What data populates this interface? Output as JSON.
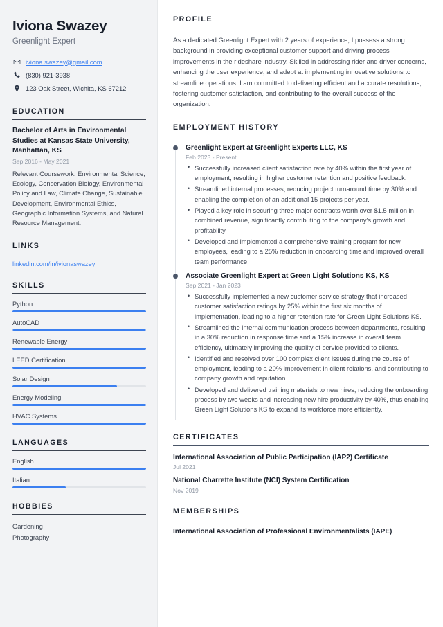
{
  "theme": {
    "accent": "#3b7ff0",
    "sidebar_bg": "#f2f3f5",
    "heading": "#1a202c",
    "body_text": "#3d4451",
    "muted": "#9199a6",
    "timeline_dot": "#4a5568"
  },
  "sidebar": {
    "name": "Iviona Swazey",
    "job_title": "Greenlight Expert",
    "contact": [
      {
        "icon": "envelope-icon",
        "text": "iviona.swazey@gmail.com",
        "is_link": true
      },
      {
        "icon": "phone-icon",
        "text": "(830) 921-3938",
        "is_link": false
      },
      {
        "icon": "location-pin-icon",
        "text": "123 Oak Street, Wichita, KS 67212",
        "is_link": false
      }
    ],
    "education": {
      "heading": "EDUCATION",
      "degree": "Bachelor of Arts in Environmental Studies at Kansas State University, Manhattan, KS",
      "date": "Sep 2016 - May 2021",
      "description": "Relevant Coursework: Environmental Science, Ecology, Conservation Biology, Environmental Policy and Law, Climate Change, Sustainable Development, Environmental Ethics, Geographic Information Systems, and Natural Resource Management."
    },
    "links": {
      "heading": "LINKS",
      "items": [
        {
          "label": "linkedin.com/in/ivionaswazey"
        }
      ]
    },
    "skills": {
      "heading": "SKILLS",
      "items": [
        {
          "label": "Python",
          "level": 100
        },
        {
          "label": "AutoCAD",
          "level": 100
        },
        {
          "label": "Renewable Energy",
          "level": 100
        },
        {
          "label": "LEED Certification",
          "level": 100
        },
        {
          "label": "Solar Design",
          "level": 78
        },
        {
          "label": "Energy Modeling",
          "level": 100
        },
        {
          "label": "HVAC Systems",
          "level": 100
        }
      ]
    },
    "languages": {
      "heading": "LANGUAGES",
      "items": [
        {
          "label": "English",
          "level": 100
        },
        {
          "label": "Italian",
          "level": 40
        }
      ]
    },
    "hobbies": {
      "heading": "HOBBIES",
      "items": [
        {
          "label": "Gardening"
        },
        {
          "label": "Photography"
        }
      ]
    }
  },
  "main": {
    "profile": {
      "heading": "PROFILE",
      "text": "As a dedicated Greenlight Expert with 2 years of experience, I possess a strong background in providing exceptional customer support and driving process improvements in the rideshare industry. Skilled in addressing rider and driver concerns, enhancing the user experience, and adept at implementing innovative solutions to streamline operations. I am committed to delivering efficient and accurate resolutions, fostering customer satisfaction, and contributing to the overall success of the organization."
    },
    "employment": {
      "heading": "EMPLOYMENT HISTORY",
      "jobs": [
        {
          "title": "Greenlight Expert at Greenlight Experts LLC, KS",
          "date": "Feb 2023 - Present",
          "bullets": [
            "Successfully increased client satisfaction rate by 40% within the first year of employment, resulting in higher customer retention and positive feedback.",
            "Streamlined internal processes, reducing project turnaround time by 30% and enabling the completion of an additional 15 projects per year.",
            "Played a key role in securing three major contracts worth over $1.5 million in combined revenue, significantly contributing to the company's growth and profitability.",
            "Developed and implemented a comprehensive training program for new employees, leading to a 25% reduction in onboarding time and improved overall team performance."
          ]
        },
        {
          "title": "Associate Greenlight Expert at Green Light Solutions KS, KS",
          "date": "Sep 2021 - Jan 2023",
          "bullets": [
            "Successfully implemented a new customer service strategy that increased customer satisfaction ratings by 25% within the first six months of implementation, leading to a higher retention rate for Green Light Solutions KS.",
            "Streamlined the internal communication process between departments, resulting in a 30% reduction in response time and a 15% increase in overall team efficiency, ultimately improving the quality of service provided to clients.",
            "Identified and resolved over 100 complex client issues during the course of employment, leading to a 20% improvement in client relations, and contributing to company growth and reputation.",
            "Developed and delivered training materials to new hires, reducing the onboarding process by two weeks and increasing new hire productivity by 40%, thus enabling Green Light Solutions KS to expand its workforce more efficiently."
          ]
        }
      ]
    },
    "certificates": {
      "heading": "CERTIFICATES",
      "items": [
        {
          "name": "International Association of Public Participation (IAP2) Certificate",
          "date": "Jul 2021"
        },
        {
          "name": "National Charrette Institute (NCI) System Certification",
          "date": "Nov 2019"
        }
      ]
    },
    "memberships": {
      "heading": "MEMBERSHIPS",
      "items": [
        {
          "name": "International Association of Professional Environmentalists (IAPE)"
        }
      ]
    }
  }
}
